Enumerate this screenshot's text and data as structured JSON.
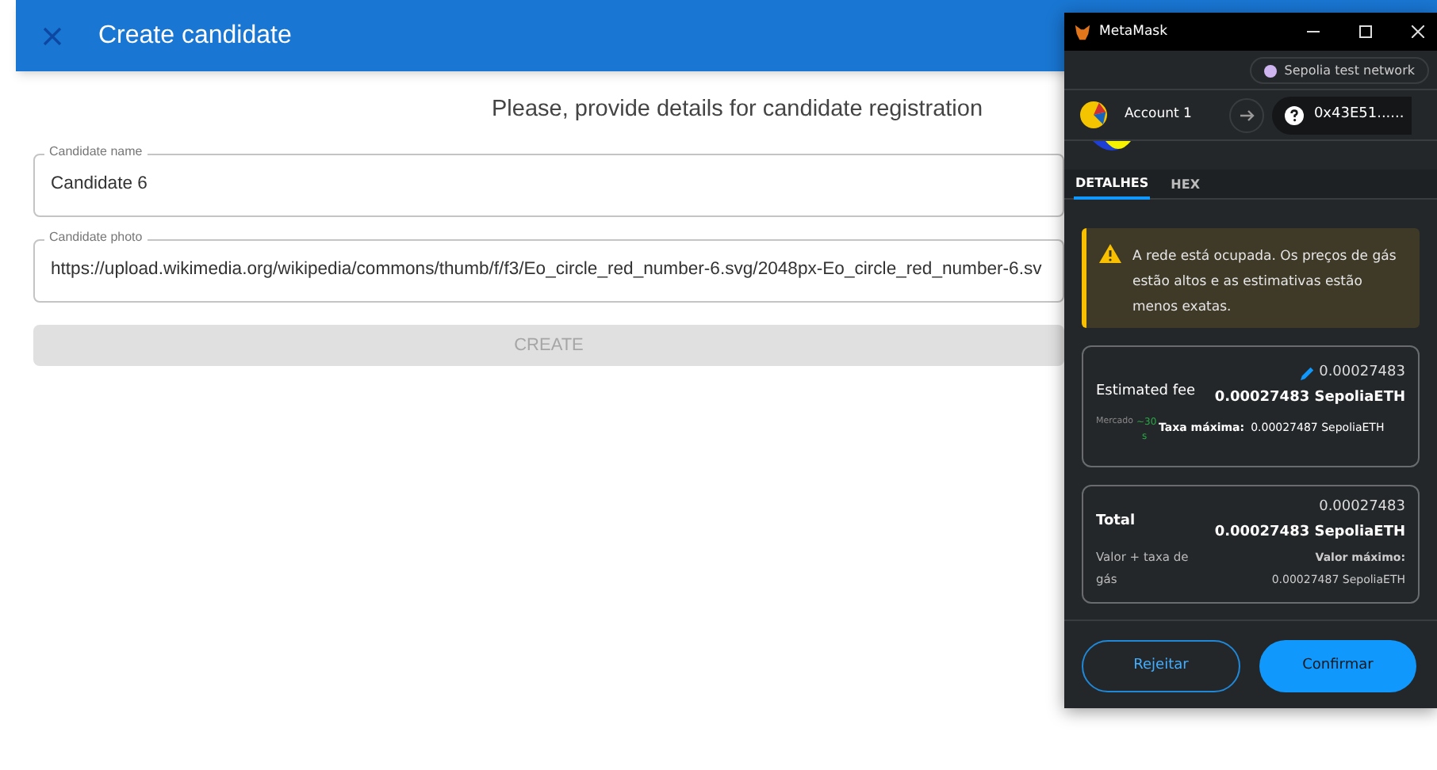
{
  "app_bar": {
    "title": "Create candidate"
  },
  "heading": "Please, provide details for candidate registration",
  "fields": [
    {
      "label": "Candidate name",
      "value": "Candidate 6"
    },
    {
      "label": "Candidate photo",
      "value": "https://upload.wikimedia.org/wikipedia/commons/thumb/f/f3/Eo_circle_red_number-6.svg/2048px-Eo_circle_red_number-6.sv"
    }
  ],
  "create_button": {
    "label": "CREATE",
    "disabled": true
  },
  "metamask": {
    "window_title": "MetaMask",
    "network": "Sepolia test network",
    "account": "Account 1",
    "address": "0x43E51......",
    "tabs": [
      {
        "label": "DETALHES",
        "selected": true
      },
      {
        "label": "HEX",
        "selected": false
      }
    ],
    "warning": "A rede está ocupada. Os preços de gás estão altos e as estimativas estão menos exatas.",
    "fee": {
      "label": "Estimated fee",
      "amount": "0.00027483",
      "amount_bold": "0.00027483 SepoliaETH",
      "speed": "Mercado",
      "time": "~30 s",
      "max_label": "Taxa máxima:",
      "max_value": "0.00027487 SepoliaETH"
    },
    "total": {
      "label": "Total",
      "amount": "0.00027483",
      "amount_bold": "0.00027483 SepoliaETH",
      "sublabel": "Valor + taxa de gás",
      "max_label": "Valor máximo:",
      "max_value": "0.00027487 SepoliaETH"
    },
    "buttons": {
      "reject": "Rejeitar",
      "confirm": "Confirmar"
    }
  }
}
